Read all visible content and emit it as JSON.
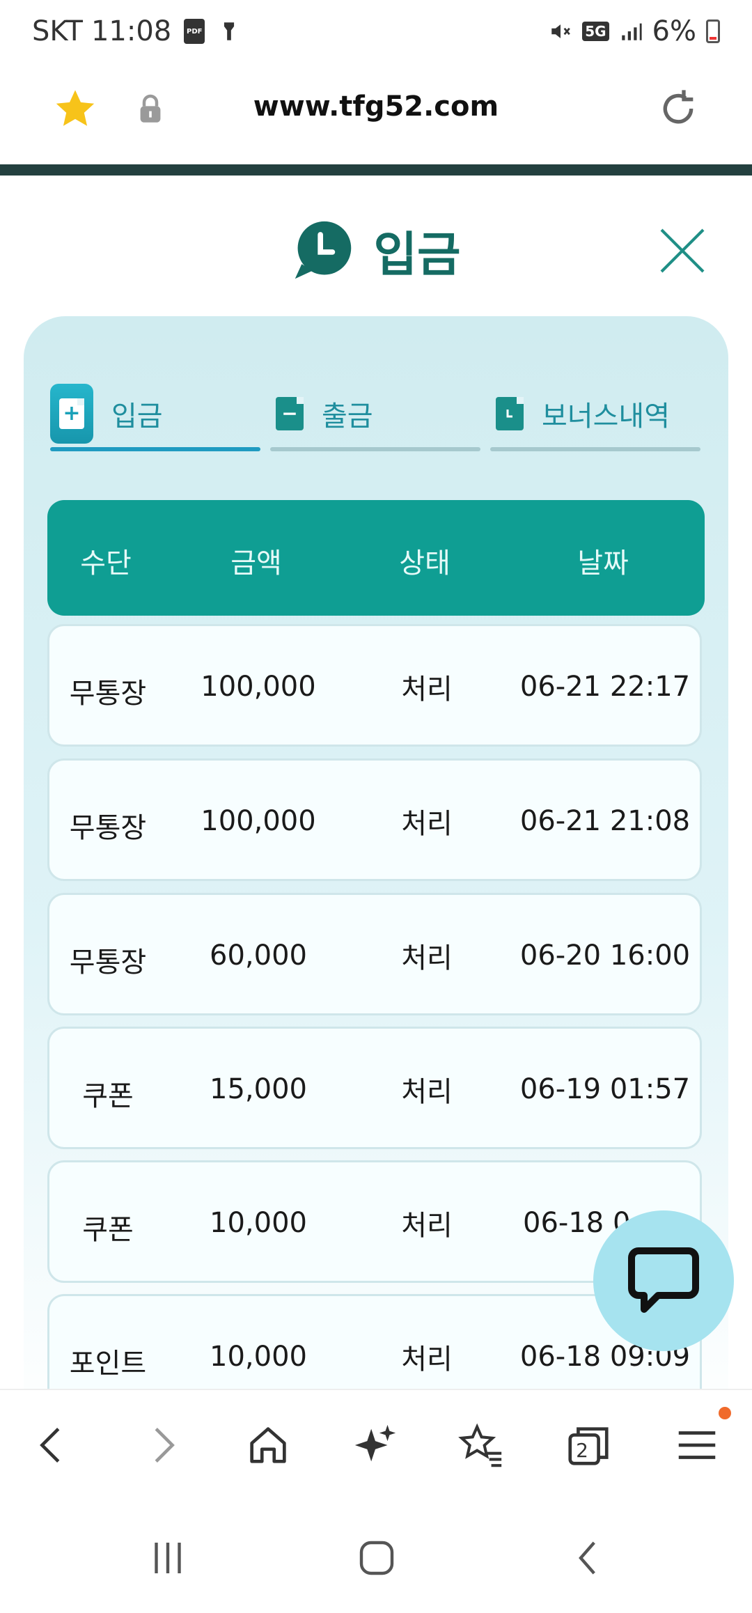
{
  "status_bar": {
    "carrier": "SKT",
    "time": "11:08",
    "pdf_badge": "PDF",
    "network": "5G",
    "battery": "6%"
  },
  "browser": {
    "url": "www.tfg52.com"
  },
  "modal": {
    "title": "입금"
  },
  "tabs": [
    {
      "label": "입금",
      "icon": "plus-document-icon",
      "active": true
    },
    {
      "label": "출금",
      "icon": "minus-document-icon",
      "active": false
    },
    {
      "label": "보너스내역",
      "icon": "clock-document-icon",
      "active": false
    }
  ],
  "table": {
    "headers": [
      "수단",
      "금액",
      "상태",
      "날짜"
    ],
    "rows": [
      [
        "무통장",
        "100,000",
        "처리",
        "06-21 22:17"
      ],
      [
        "무통장",
        "100,000",
        "처리",
        "06-21 21:08"
      ],
      [
        "무통장",
        "60,000",
        "처리",
        "06-20 16:00"
      ],
      [
        "쿠폰",
        "15,000",
        "처리",
        "06-19 01:57"
      ],
      [
        "쿠폰",
        "10,000",
        "처리",
        "06-18 0"
      ],
      [
        "포인트",
        "10,000",
        "처리",
        "06-18 09:09"
      ]
    ]
  },
  "toolbar": {
    "tab_count": "2"
  },
  "colors": {
    "accent": "#0f9e93",
    "title": "#156b63",
    "tab_text": "#1f8e9e",
    "chat_fab": "#a6e3ef"
  }
}
